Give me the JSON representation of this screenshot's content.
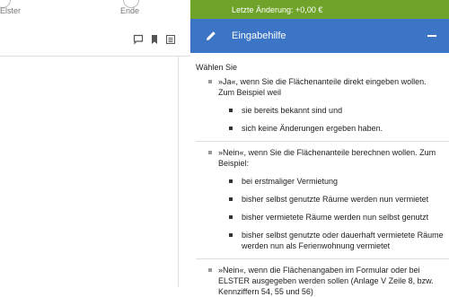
{
  "steps": [
    {
      "label": "Elster"
    },
    {
      "label": "Ende"
    }
  ],
  "toolbar": {
    "icons": [
      "comment-icon",
      "bookmark-icon",
      "list-icon"
    ]
  },
  "status": {
    "last_change": "Letzte Änderung: +0,00 €"
  },
  "help": {
    "title": "Eingabehilfe",
    "intro": "Wählen Sie",
    "options": [
      {
        "text": "»Ja«, wenn Sie die Flächenanteile direkt eingeben wollen. Zum Beispiel weil",
        "sub": [
          "sie bereits bekannt sind und",
          "sich keine Änderungen ergeben haben."
        ]
      },
      {
        "text": "»Nein«, wenn Sie die Flächenanteile berechnen wollen. Zum Beispiel:",
        "sub": [
          "bei erstmaliger Vermietung",
          "bisher selbst genutzte Räume werden nun vermietet",
          "bisher vermietete Räume werden nun selbst genutzt",
          "bisher selbst genutzte oder dauerhaft vermietete Räume werden nun als Ferienwohnung vermietet"
        ]
      },
      {
        "text": "»Nein«, wenn die Flächenangaben im Formular oder bei ELSTER ausgegeben werden sollen (Anlage V Zeile 8, bzw. Kennziffern 54, 55 und 56)",
        "sub": []
      }
    ]
  },
  "colors": {
    "status_bar": "#6fa329",
    "help_header": "#3d75c6"
  }
}
